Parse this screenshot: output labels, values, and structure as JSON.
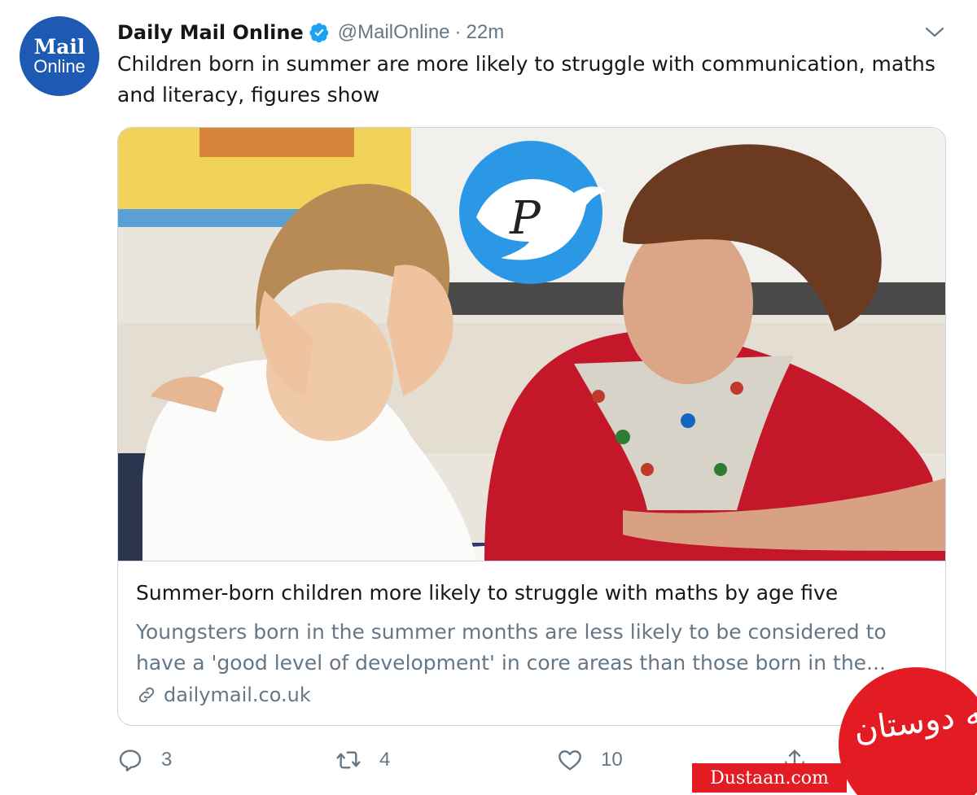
{
  "tweet": {
    "avatar": {
      "line1": "Mail",
      "line2": "Online",
      "color": "#1e5ab4"
    },
    "author_name": "Daily Mail Online",
    "handle": "@MailOnline",
    "separator": "·",
    "time": "22m",
    "text": "Children born in summer are more likely to struggle with communication, maths and literacy, figures show",
    "verified_color": "#1da1f2"
  },
  "card": {
    "title": "Summer-born children more likely to struggle with maths by age five",
    "description": "Youngsters born in the summer months are less likely to be considered to have a 'good level of development' in core areas than those born in the...",
    "domain": "dailymail.co.uk",
    "photo_alt": "Boy holding his head while a teacher helps him at a desk",
    "overlay_logo_letter": "P"
  },
  "actions": {
    "reply_count": "3",
    "retweet_count": "4",
    "like_count": "10"
  },
  "watermark": {
    "circle_text": "مجله دوستان",
    "bar_text": "Dustaan.com",
    "color": "#e31b23"
  }
}
